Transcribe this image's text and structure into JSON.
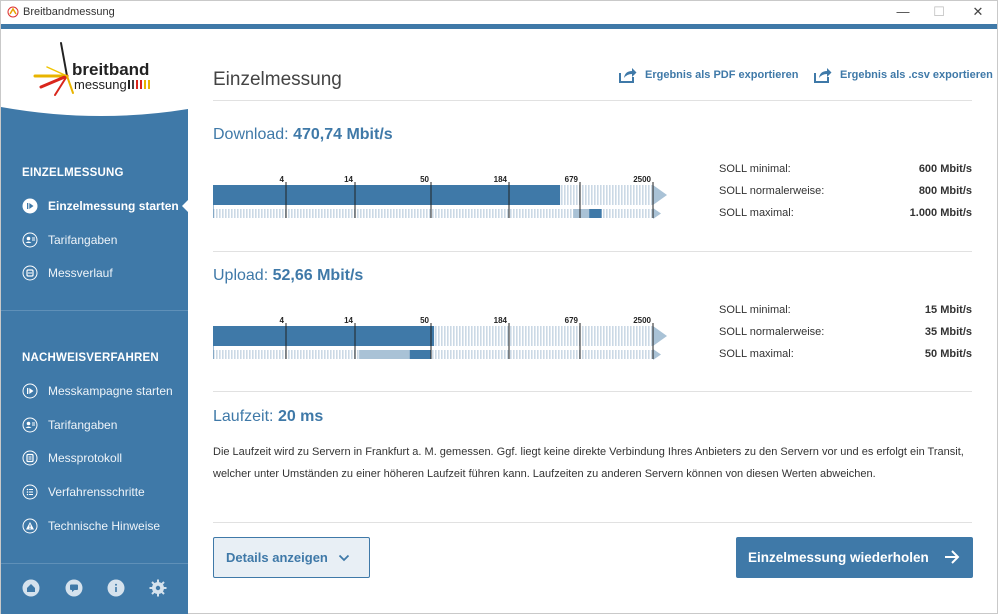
{
  "window": {
    "title": "Breitbandmessung",
    "minimize": "—",
    "maximize": "☐",
    "close": "✕"
  },
  "logo": {
    "line1": "breitband",
    "line2": "messung"
  },
  "sidebar": {
    "section1_heading": "EINZELMESSUNG",
    "section1_items": [
      {
        "label": "Einzelmessung starten",
        "icon": "play-circle-icon"
      },
      {
        "label": "Tarifangaben",
        "icon": "user-tariff-icon"
      },
      {
        "label": "Messverlauf",
        "icon": "history-icon"
      }
    ],
    "section2_heading": "NACHWEISVERFAHREN",
    "section2_items": [
      {
        "label": "Messkampagne starten",
        "icon": "play-circle-icon"
      },
      {
        "label": "Tarifangaben",
        "icon": "user-tariff-icon"
      },
      {
        "label": "Messprotokoll",
        "icon": "protocol-icon"
      },
      {
        "label": "Verfahrensschritte",
        "icon": "steps-list-icon"
      },
      {
        "label": "Technische Hinweise",
        "icon": "warning-icon"
      }
    ],
    "footer_icons": [
      "home-icon",
      "chat-icon",
      "info-icon",
      "settings-icon"
    ]
  },
  "main": {
    "title": "Einzelmessung",
    "export_pdf": "Ergebnis als PDF exportieren",
    "export_csv": "Ergebnis als .csv exportieren",
    "scale_labels": [
      "4",
      "14",
      "50",
      "184",
      "679",
      "2500"
    ],
    "download": {
      "label": "Download:",
      "value": "470,74 Mbit/s",
      "measured_mbit": 470.74,
      "soll": [
        {
          "label": "SOLL minimal:",
          "value": "600 Mbit/s",
          "mbit": 600
        },
        {
          "label": "SOLL normalerweise:",
          "value": "800 Mbit/s",
          "mbit": 800
        },
        {
          "label": "SOLL maximal:",
          "value": "1.000 Mbit/s",
          "mbit": 1000
        }
      ]
    },
    "upload": {
      "label": "Upload:",
      "value": "52,66 Mbit/s",
      "measured_mbit": 52.66,
      "soll": [
        {
          "label": "SOLL minimal:",
          "value": "15 Mbit/s",
          "mbit": 15
        },
        {
          "label": "SOLL normalerweise:",
          "value": "35 Mbit/s",
          "mbit": 35
        },
        {
          "label": "SOLL maximal:",
          "value": "50 Mbit/s",
          "mbit": 50
        }
      ]
    },
    "latency": {
      "label": "Laufzeit:",
      "value": "20 ms",
      "description": "Die Laufzeit wird zu Servern in Frankfurt a. M. gemessen. Ggf. liegt keine direkte Verbindung Ihres Anbieters zu den Servern vor und es erfolgt ein Transit, welcher unter Umständen zu einer höheren Laufzeit führen kann. Laufzeiten zu anderen Servern können von diesen Werten abweichen."
    },
    "details_button": "Details anzeigen",
    "repeat_button": "Einzelmessung wiederholen"
  },
  "colors": {
    "brand": "#3f79a8",
    "bar_light": "#a9c2d6",
    "bar_pale": "#cbd9e5"
  }
}
